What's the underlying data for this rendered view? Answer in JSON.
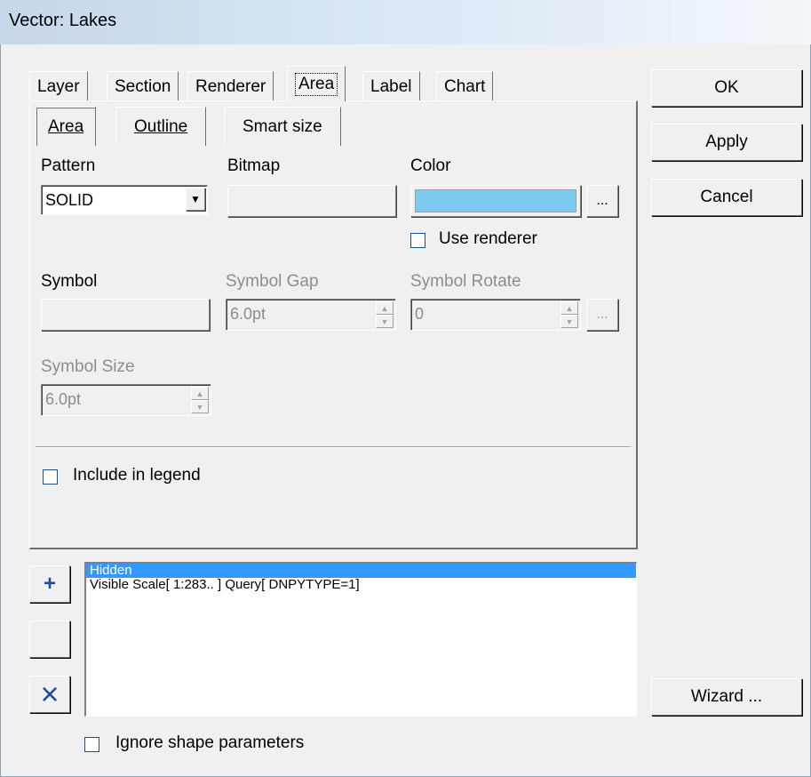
{
  "window": {
    "title": "Vector: Lakes"
  },
  "tabs": [
    "Layer",
    "Section",
    "Renderer",
    "Area",
    "Label",
    "Chart"
  ],
  "active_tab": "Area",
  "subtabs": [
    "Area",
    "Outline",
    "Smart size"
  ],
  "active_subtab": "Area",
  "fields": {
    "pattern_label": "Pattern",
    "pattern_value": "SOLID",
    "bitmap_label": "Bitmap",
    "color_label": "Color",
    "color_value": "#7ecaf0",
    "color_more": "...",
    "use_renderer_label": "Use renderer",
    "symbol_label": "Symbol",
    "symbol_gap_label": "Symbol Gap",
    "symbol_gap_value": "6.0pt",
    "symbol_rotate_label": "Symbol Rotate",
    "symbol_rotate_value": "0",
    "symbol_rotate_more": "...",
    "symbol_size_label": "Symbol Size",
    "symbol_size_value": "6.0pt",
    "include_legend_label": "Include in legend"
  },
  "buttons": {
    "ok": "OK",
    "apply": "Apply",
    "cancel": "Cancel",
    "wizard": "Wizard ...",
    "add": "+",
    "remove": "×"
  },
  "rules_list": [
    "Hidden",
    "Visible Scale[ 1:283.. ] Query[ DNPYTYPE=1]"
  ],
  "selected_rule_index": 0,
  "ignore_shape_label": "Ignore shape parameters",
  "colors": {
    "selection": "#3399ff",
    "remove_icon": "#1f4f9c",
    "add_icon": "#1f4f9c"
  }
}
